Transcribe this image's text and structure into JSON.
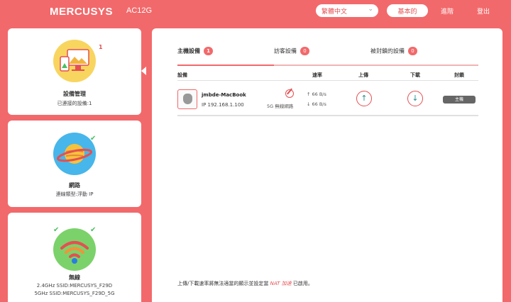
{
  "header": {
    "brand": "MERCUSYS",
    "model": "AC12G",
    "language": "繁體中文",
    "nav_basic": "基本的",
    "nav_advanced": "進階",
    "nav_logout": "登出"
  },
  "sidebar": {
    "device_card": {
      "title": "設備管理",
      "subtitle": "已連接的設備:1",
      "badge": "1"
    },
    "network_card": {
      "title": "網路",
      "subtitle": "連線類型:浮動 IP"
    },
    "wireless_card": {
      "title": "無線",
      "ssid_24": "2.4GHz SSID:MERCUSYS_F29D",
      "ssid_5": "5GHz SSID:MERCUSYS_F29D_5G"
    }
  },
  "tabs": [
    {
      "label": "主機設備",
      "count": "1"
    },
    {
      "label": "訪客設備",
      "count": "0"
    },
    {
      "label": "被封鎖的設備",
      "count": "0"
    }
  ],
  "table": {
    "columns": [
      "設備",
      "速率",
      "上傳",
      "下載",
      "封鎖"
    ],
    "rows": [
      {
        "name": "jmbde-MacBook",
        "ip": "IP 192.168.1.100",
        "band": "5G 無線網路",
        "up_speed": "↑ 66 B/s",
        "down_speed": "↓ 66 B/s",
        "block_label": "主機"
      }
    ]
  },
  "footnote": {
    "prefix": "上傳/下載速率將無法適當的顯示並設定當",
    "nat": "NAT 加速",
    "suffix": "已啟用。"
  },
  "colors": {
    "accent": "#f2696b",
    "brand_red": "#e54f52",
    "success": "#4cbf62"
  }
}
